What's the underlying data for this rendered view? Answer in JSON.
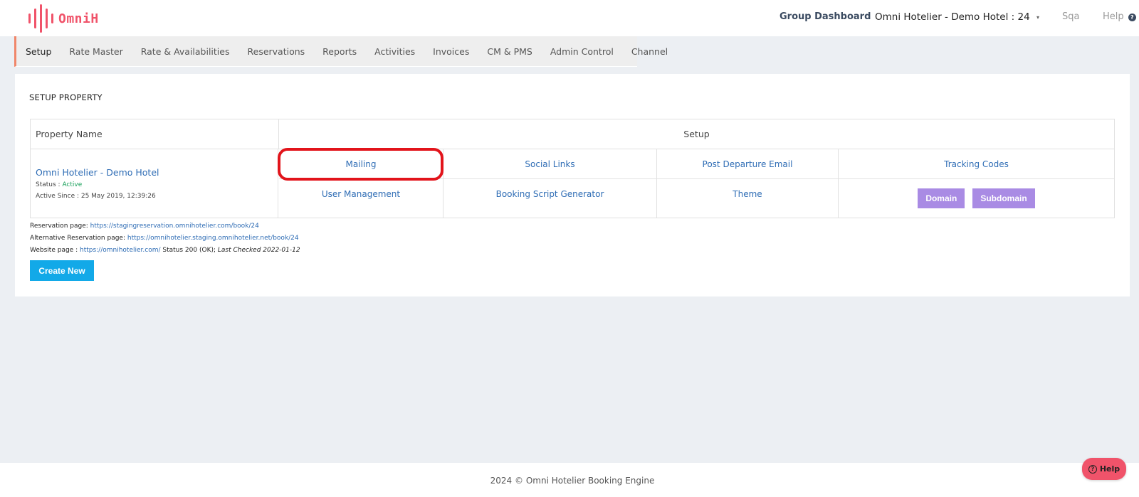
{
  "header": {
    "logo_text": "OmniH",
    "group_dashboard": "Group Dashboard",
    "hotel_selector": "Omni Hotelier - Demo Hotel : 24",
    "caret": "▾",
    "user": "Sqa",
    "help": "Help",
    "help_icon": "?"
  },
  "nav": {
    "items": [
      {
        "label": "Setup"
      },
      {
        "label": "Rate Master"
      },
      {
        "label": "Rate & Availabilities"
      },
      {
        "label": "Reservations"
      },
      {
        "label": "Reports"
      },
      {
        "label": "Activities"
      },
      {
        "label": "Invoices"
      },
      {
        "label": "CM & PMS"
      },
      {
        "label": "Admin Control"
      },
      {
        "label": "Channel"
      }
    ]
  },
  "main": {
    "section_title": "SETUP PROPERTY",
    "table": {
      "header_property": "Property Name",
      "header_setup": "Setup",
      "property_name": "Omni Hotelier - Demo Hotel",
      "status_label": "Status : ",
      "status_value": "Active",
      "active_since": "Active Since : 25 May 2019, 12:39:26",
      "links_row1": [
        "Mailing",
        "Social Links",
        "Post Departure Email",
        "Tracking Codes"
      ],
      "links_row2": [
        "User Management",
        "Booking Script Generator",
        "Theme"
      ],
      "domain_button": "Domain",
      "subdomain_button": "Subdomain"
    },
    "reservation_label": "Reservation page: ",
    "reservation_url": "https://stagingreservation.omnihotelier.com/book/24",
    "alt_reservation_label": "Alternative Reservation page: ",
    "alt_reservation_url": "https://omnihotelier.staging.omnihotelier.net/book/24",
    "website_label": "Website page : ",
    "website_url": "https://omnihotelier.com/",
    "website_status": " Status 200 (OK); ",
    "last_checked": "Last Checked 2022-01-12",
    "create_new": "Create New"
  },
  "footer": {
    "copyright": "2024 © Omni Hotelier Booking Engine",
    "help_button": "Help",
    "help_icon": "?"
  },
  "colors": {
    "brand": "#f0536a",
    "link": "#2f6db5",
    "purple": "#a98be4",
    "create_button": "#12a9e8",
    "highlight": "#e2141b"
  }
}
